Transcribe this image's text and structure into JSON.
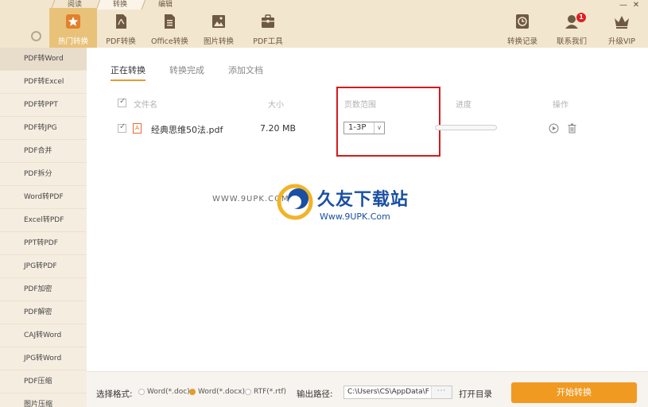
{
  "top_tabs": [
    "阅读",
    "转换",
    "编辑"
  ],
  "window_controls": {
    "minimize": "—",
    "close": "✕"
  },
  "toolbar": [
    {
      "label": "热门转换",
      "icon": "star-icon"
    },
    {
      "label": "PDF转换",
      "icon": "pdf-icon"
    },
    {
      "label": "Office转换",
      "icon": "office-icon"
    },
    {
      "label": "图片转换",
      "icon": "image-icon"
    },
    {
      "label": "PDF工具",
      "icon": "toolbox-icon"
    }
  ],
  "toolbar_right": [
    {
      "label": "转换记录",
      "icon": "clock-icon"
    },
    {
      "label": "联系我们",
      "icon": "contact-icon",
      "badge": "1"
    },
    {
      "label": "升级VIP",
      "icon": "crown-icon"
    }
  ],
  "sidebar": [
    "PDF转Word",
    "PDF转Excel",
    "PDF转PPT",
    "PDF转JPG",
    "PDF合并",
    "PDF拆分",
    "Word转PDF",
    "Excel转PDF",
    "PPT转PDF",
    "JPG转PDF",
    "PDF加密",
    "PDF解密",
    "CAJ转Word",
    "JPG转Word",
    "PDF压缩",
    "图片压缩"
  ],
  "subtabs": [
    "正在转换",
    "转换完成",
    "添加文档"
  ],
  "table": {
    "headers": {
      "name": "文件名",
      "size": "大小",
      "pages": "页数范围",
      "progress": "进度",
      "ops": "操作"
    },
    "rows": [
      {
        "name": "经典思维50法.pdf",
        "size": "7.20 MB",
        "pages": "1-3P",
        "progress": 0
      }
    ]
  },
  "watermark": {
    "left": "WWW.9UPK.COM",
    "title": "久友下载站",
    "url": "Www.9UPK.Com"
  },
  "bottom": {
    "format_label": "选择格式:",
    "formats": [
      {
        "label": "Word(*.doc)",
        "selected": false
      },
      {
        "label": "Word(*.docx)",
        "selected": true
      },
      {
        "label": "RTF(*.rtf)",
        "selected": false
      }
    ],
    "path_label": "输出路径:",
    "path_value": "C:\\Users\\CS\\AppData\\F",
    "path_browse": "···",
    "open_dir": "打开目录",
    "start": "开始转换"
  },
  "colors": {
    "accent": "#f09a22",
    "header_bg": "#f3e6cf",
    "sidebar_bg": "#f5ede0",
    "highlight_box": "#d81a1a"
  }
}
